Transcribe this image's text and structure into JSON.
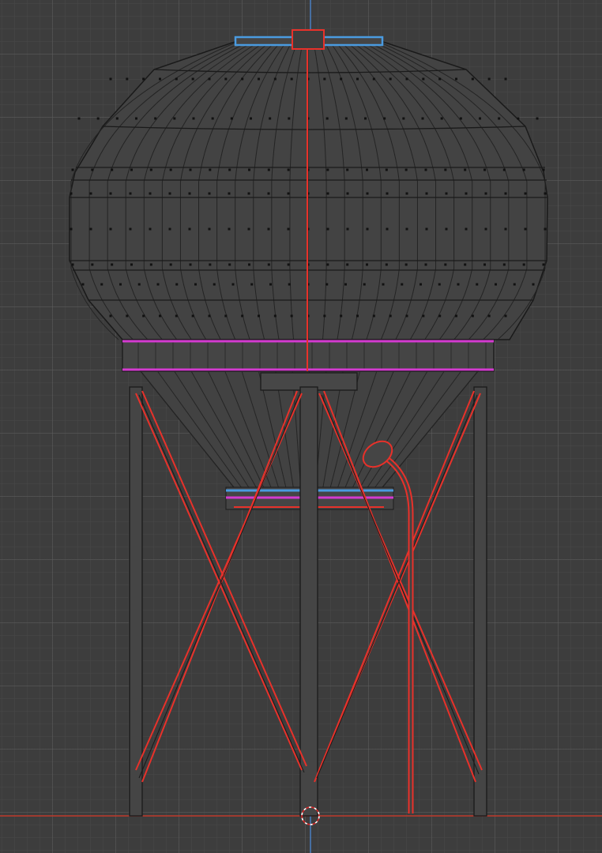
{
  "viewport": {
    "mode": "wireframe",
    "colors": {
      "background": "#3d3d3d",
      "wire": "#1c1c1c",
      "selected_edge": "#e8312a",
      "seam_pink": "#d43ad0",
      "seam_blue": "#4a9be0",
      "x_axis": "#c0392b",
      "z_axis": "#4a7fc1",
      "cursor": "#ffffff"
    }
  },
  "scene": {
    "object": "water-tower",
    "parts": [
      "tank-dome",
      "tank-band",
      "cone-bottom",
      "hatch",
      "legs",
      "cross-braces",
      "outlet-pipe",
      "center-pole"
    ],
    "icons": [
      "3d-cursor-icon"
    ]
  }
}
